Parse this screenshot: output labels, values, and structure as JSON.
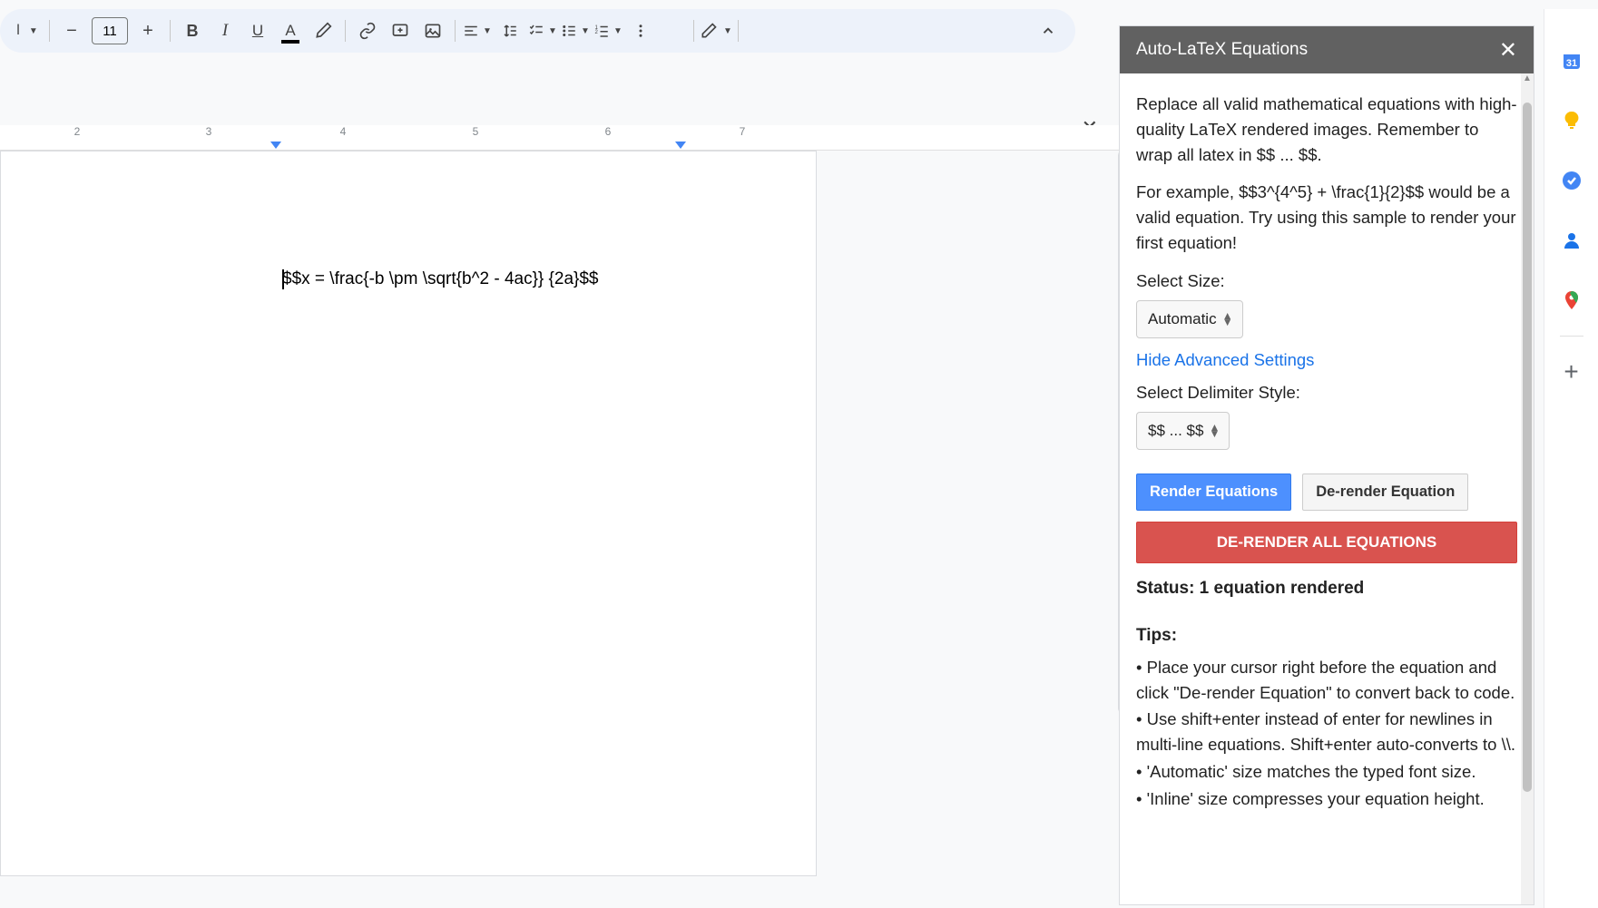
{
  "toolbar": {
    "font_size": "11",
    "styles_dropdown": "",
    "icons": {
      "minus": "−",
      "plus": "+"
    }
  },
  "ruler": {
    "ticks": [
      "2",
      "3",
      "4",
      "5",
      "6",
      "7"
    ]
  },
  "document": {
    "content": "$$x = \\frac{-b \\pm \\sqrt{b^2 - 4ac}} {2a}$$"
  },
  "sidebar": {
    "title": "Auto-LaTeX Equations",
    "intro": "Replace all valid mathematical equations with high-quality LaTeX rendered images. Remember to wrap all latex in $$ ... $$.",
    "example": "For example, $$3^{4^5} + \\frac{1}{2}$$ would be a valid equation. Try using this sample to render your first equation!",
    "size_label": "Select Size:",
    "size_value": "Automatic",
    "advanced_link": "Hide Advanced Settings",
    "delimiter_label": "Select Delimiter Style:",
    "delimiter_value": "$$ ... $$",
    "render_btn": "Render Equations",
    "derender_btn": "De-render Equation",
    "derender_all_btn": "DE-RENDER ALL EQUATIONS",
    "status": "Status: 1 equation rendered",
    "tips_heading": "Tips:",
    "tips": [
      "• Place your cursor right before the equation and click \"De-render Equation\" to convert back to code.",
      "• Use shift+enter instead of enter for newlines in multi-line equations. Shift+enter auto-converts to \\\\.",
      "• 'Automatic' size matches the typed font size.",
      "• 'Inline' size compresses your equation height."
    ]
  }
}
